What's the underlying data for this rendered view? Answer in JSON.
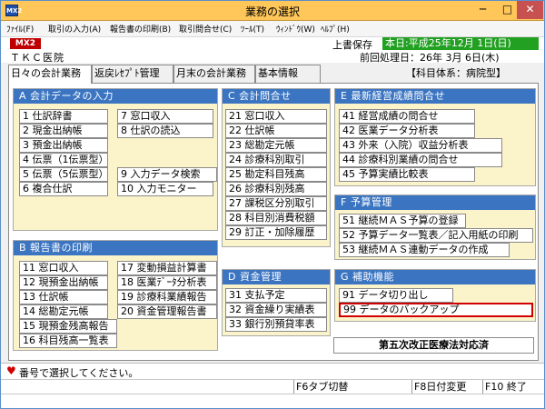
{
  "window": {
    "title": "業務の選択",
    "app_icon": "MX2",
    "min": "─",
    "max": "□",
    "close": "✕"
  },
  "menu": [
    "ﾌｧｲﾙ(F)",
    "取引の入力(A)",
    "報告書の印刷(B)",
    "取引問合せ(C)",
    "ﾂｰﾙ(T)",
    "ｳｨﾝﾄﾞｳ(W)",
    "ﾍﾙﾌﾟ(H)"
  ],
  "header": {
    "badge": "MX2",
    "save": "上書保存",
    "date": "本日:平成25年12月 1日(日)",
    "hospital": "ＴＫＣ医院",
    "prev_process": "前回処理日：26年 3月 6日(木)"
  },
  "tabs": [
    "日々の会計業務",
    "返戻ﾚｾﾌﾟﾄ管理",
    "月末の会計業務",
    "基本情報"
  ],
  "subject_system": "【科目体系：病院型】",
  "panels": {
    "a": {
      "title": "A 会計データの入力",
      "items": [
        "1 仕訳辞書",
        "2 現金出納帳",
        "3 預金出納帳",
        "4 伝票（1伝票型）",
        "5 伝票（5伝票型）",
        "6 複合仕訳",
        "7 窓口収入",
        "8 仕訳の読込",
        "9 入力データ検索",
        "10 入力モニター"
      ]
    },
    "b": {
      "title": "B 報告書の印刷",
      "items": [
        "11 窓口収入",
        "12 現預金出納帳",
        "13 仕訳帳",
        "14 総勘定元帳",
        "15 現預金残高報告",
        "16 科目残高一覧表",
        "17 変動損益計算書",
        "18 医業ﾃﾞｰﾀ分析表",
        "19 診療科業績報告",
        "20 資金管理報告書"
      ]
    },
    "c": {
      "title": "C 会計問合せ",
      "items": [
        "21 窓口収入",
        "22 仕訳帳",
        "23 総勘定元帳",
        "24 診療科別取引",
        "25 勘定科目残高",
        "26 診療科別残高",
        "27 課税区分別取引",
        "28 科目別消費税額",
        "29 訂正・加除履歴"
      ]
    },
    "d": {
      "title": "D 資金管理",
      "items": [
        "31 支払予定",
        "32 資金繰り実績表",
        "33 銀行別預貸率表"
      ]
    },
    "e": {
      "title": "E 最新経営成績問合せ",
      "items": [
        "41 経営成績の問合せ",
        "42 医業データ分析表",
        "43 外来（入院）収益分析表",
        "44 診療科別業績の問合せ",
        "45 予算実績比較表"
      ]
    },
    "f": {
      "title": "F 予算管理",
      "items": [
        "51 継続ＭＡＳ予算の登録",
        "52 予算データ一覧表／記入用紙の印刷",
        "53 継続ＭＡＳ連動データの作成"
      ]
    },
    "g": {
      "title": "G 補助機能",
      "items": [
        "91 データ切り出し",
        "99 データのバックアップ"
      ]
    }
  },
  "notice": "第五次改正医療法対応済",
  "status": "番号で選択してください。",
  "fkeys": [
    "F6タブ切替",
    "F8日付変更",
    "F10 終了"
  ]
}
